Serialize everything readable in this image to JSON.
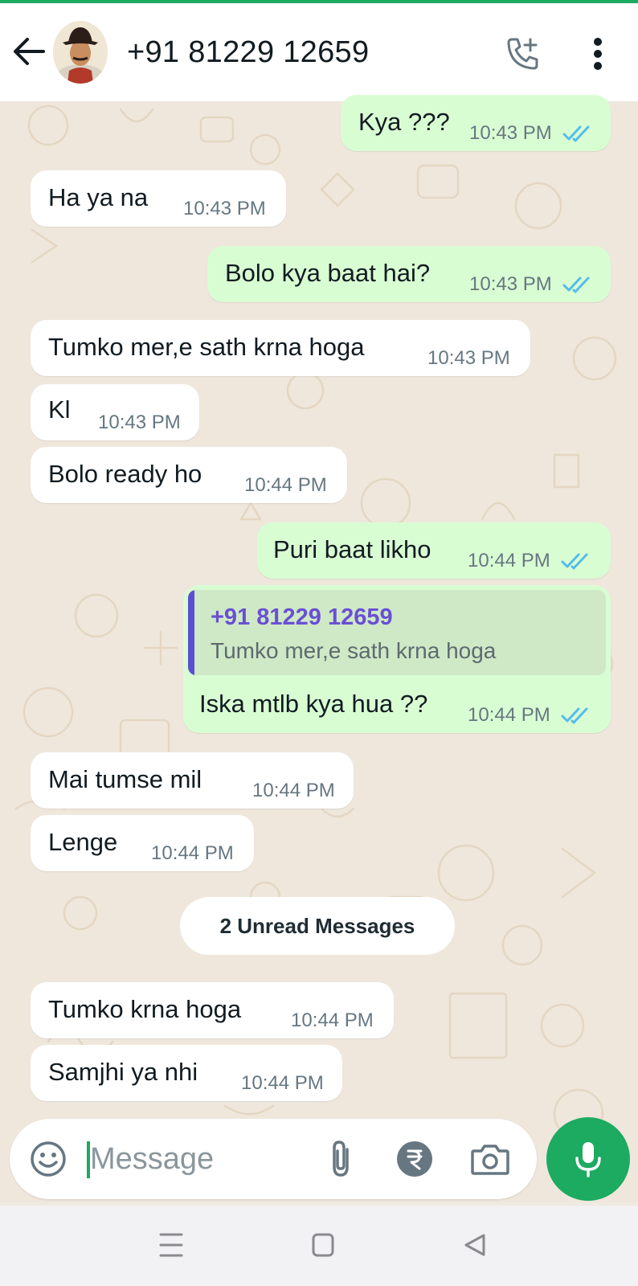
{
  "header": {
    "contact": "+91 81229 12659"
  },
  "messages": [
    {
      "text": "Kya ???",
      "time": "10:43 PM",
      "direction": "outgoing",
      "status": "read"
    },
    {
      "text": "Ha ya na",
      "time": "10:43 PM",
      "direction": "incoming"
    },
    {
      "text": "Bolo kya baat hai?",
      "time": "10:43 PM",
      "direction": "outgoing",
      "status": "read"
    },
    {
      "text": "Tumko mer,e sath krna hoga",
      "time": "10:43 PM",
      "direction": "incoming"
    },
    {
      "text": "Kl",
      "time": "10:43 PM",
      "direction": "incoming"
    },
    {
      "text": "Bolo ready ho",
      "time": "10:44 PM",
      "direction": "incoming"
    },
    {
      "text": "Puri baat likho",
      "time": "10:44 PM",
      "direction": "outgoing",
      "status": "read"
    },
    {
      "text": "Iska mtlb kya hua ??",
      "time": "10:44 PM",
      "direction": "outgoing",
      "status": "read",
      "reply_to": {
        "name": "+91 81229 12659",
        "text": "Tumko mer,e sath krna hoga"
      }
    },
    {
      "text": "Mai tumse mil",
      "time": "10:44 PM",
      "direction": "incoming"
    },
    {
      "text": "Lenge",
      "time": "10:44 PM",
      "direction": "incoming"
    },
    {
      "text": "Tumko krna hoga",
      "time": "10:44 PM",
      "direction": "incoming"
    },
    {
      "text": "Samjhi ya nhi",
      "time": "10:44 PM",
      "direction": "incoming"
    }
  ],
  "unread_banner": "2 Unread Messages",
  "composer": {
    "placeholder": "Message"
  },
  "colors": {
    "accent": "#1daa61",
    "outgoing_bubble": "#d9fdd3",
    "incoming_bubble": "#ffffff",
    "read_ticks": "#53bdeb",
    "chat_background": "#efe7dc",
    "quote_name": "#6a4fd4"
  },
  "icons": [
    "back-arrow-icon",
    "add-call-icon",
    "more-vert-icon",
    "double-check-icon",
    "emoji-icon",
    "attach-icon",
    "rupee-payment-icon",
    "camera-icon",
    "mic-icon",
    "nav-menu-icon",
    "nav-home-icon",
    "nav-back-icon"
  ]
}
